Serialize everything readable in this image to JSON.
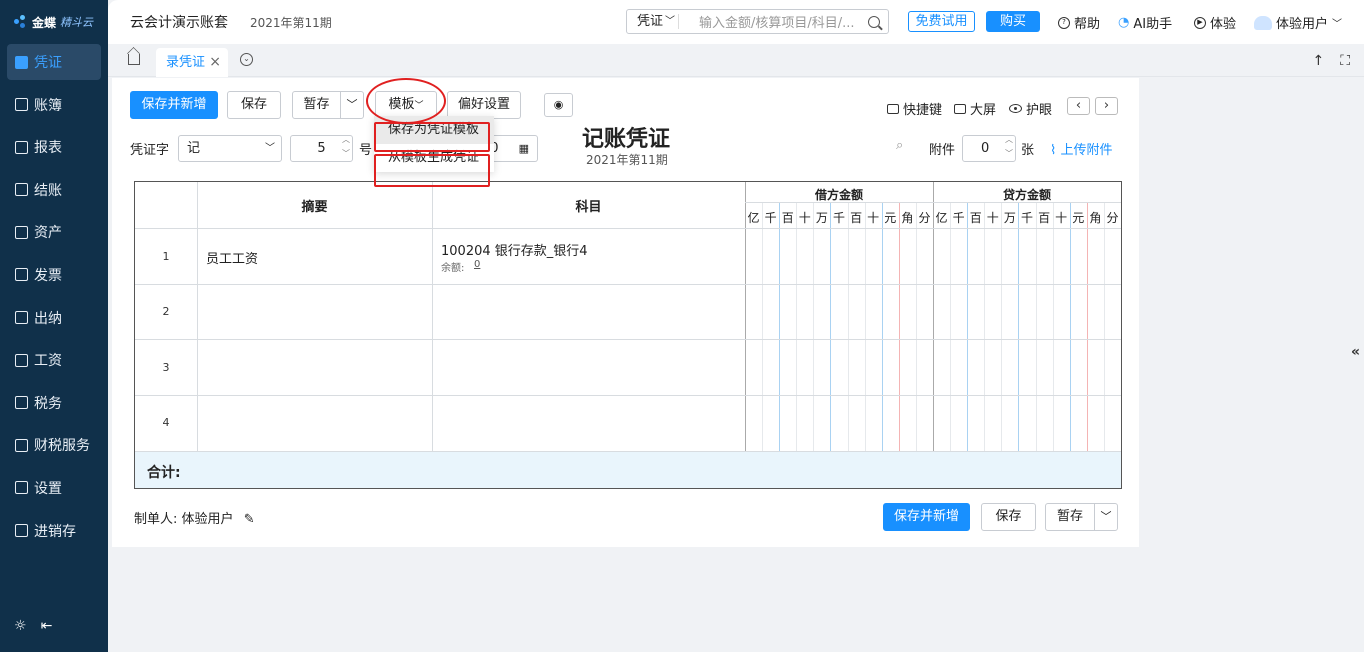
{
  "sidebar": {
    "brand": "金蝶",
    "brand_sub": "精斗云",
    "items": [
      {
        "label": "凭证",
        "icon": "voucher-icon",
        "active": true
      },
      {
        "label": "账簿",
        "icon": "ledger-icon"
      },
      {
        "label": "报表",
        "icon": "report-icon"
      },
      {
        "label": "结账",
        "icon": "closing-icon"
      },
      {
        "label": "资产",
        "icon": "asset-icon"
      },
      {
        "label": "发票",
        "icon": "invoice-icon"
      },
      {
        "label": "出纳",
        "icon": "cashier-icon"
      },
      {
        "label": "工资",
        "icon": "salary-icon"
      },
      {
        "label": "税务",
        "icon": "tax-icon"
      },
      {
        "label": "财税服务",
        "icon": "service-icon"
      },
      {
        "label": "设置",
        "icon": "settings-icon"
      },
      {
        "label": "进销存",
        "icon": "inventory-icon"
      }
    ],
    "accent": "#3aa0ff",
    "bg": "#10304a"
  },
  "header": {
    "account": "云会计演示账套",
    "period": "2021年第11期",
    "search_type": "凭证",
    "search_placeholder": "输入金额/核算项目/科目/...",
    "trial_label": "免费试用",
    "buy_label": "购买",
    "help_label": "帮助",
    "ai_label": "AI助手",
    "experience_label": "体验",
    "user_label": "体验用户"
  },
  "tabs": {
    "active_label": "录凭证"
  },
  "toolbar": {
    "save_new": "保存并新增",
    "save": "保存",
    "draft": "暂存",
    "template": "模板",
    "preferences": "偏好设置",
    "shortcuts": "快捷键",
    "fullscreen": "大屏",
    "eye_care": "护眼"
  },
  "template_menu": {
    "items": [
      "保存为凭证模板",
      "从模板生成凭证"
    ]
  },
  "voucher": {
    "word_label": "凭证字",
    "word_value": "记",
    "number_value": "5",
    "number_suffix": "号",
    "date_partial": "30",
    "title": "记账凭证",
    "period": "2021年第11期",
    "attach_label": "附件",
    "attach_value": "0",
    "attach_unit": "张",
    "upload_label": "上传附件"
  },
  "table": {
    "col_summary": "摘要",
    "col_account": "科目",
    "col_debit": "借方金额",
    "col_credit": "贷方金额",
    "digits": [
      "亿",
      "千",
      "百",
      "十",
      "万",
      "千",
      "百",
      "十",
      "元",
      "角",
      "分"
    ],
    "rows": [
      {
        "num": "1",
        "summary": "员工工资",
        "account": "100204 银行存款_银行4",
        "balance_label": "余额:",
        "balance_value": "0"
      },
      {
        "num": "2",
        "summary": "",
        "account": ""
      },
      {
        "num": "3",
        "summary": "",
        "account": ""
      },
      {
        "num": "4",
        "summary": "",
        "account": ""
      }
    ],
    "total_label": "合计:"
  },
  "footer": {
    "creator_label": "制单人:",
    "creator_value": "体验用户",
    "save_new": "保存并新增",
    "save": "保存",
    "draft": "暂存"
  }
}
